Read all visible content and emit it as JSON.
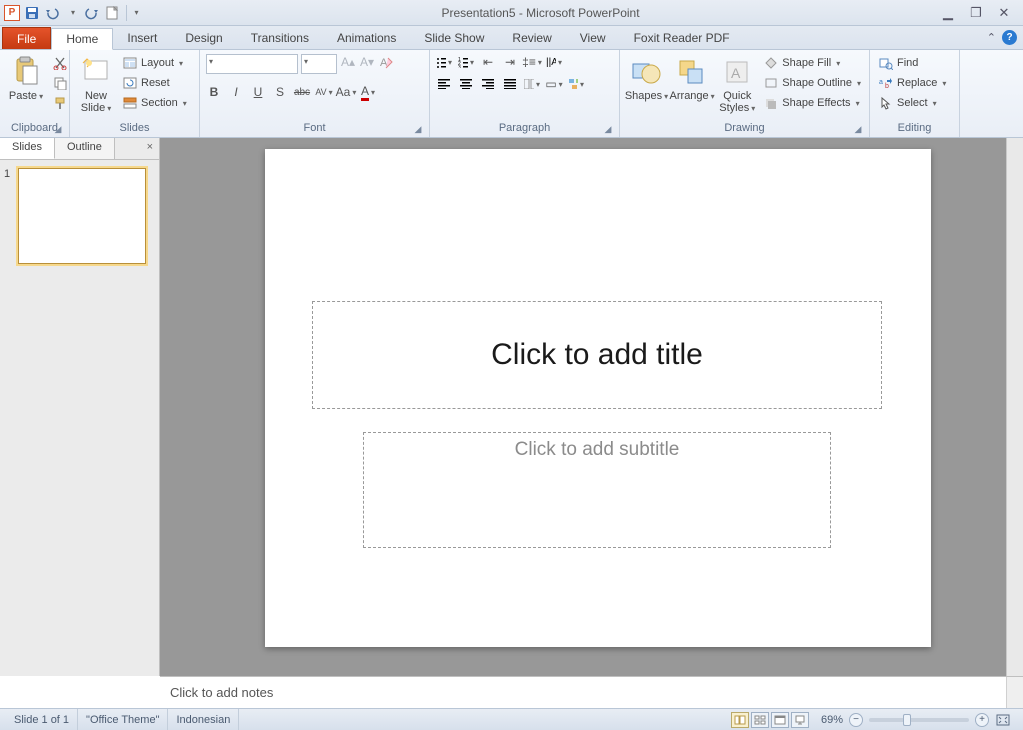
{
  "titlebar": {
    "app_letter": "P",
    "title": "Presentation5 - Microsoft PowerPoint"
  },
  "tabs": {
    "file": "File",
    "items": [
      "Home",
      "Insert",
      "Design",
      "Transitions",
      "Animations",
      "Slide Show",
      "Review",
      "View",
      "Foxit Reader PDF"
    ],
    "active_index": 0
  },
  "ribbon": {
    "clipboard": {
      "label": "Clipboard",
      "paste": "Paste",
      "cut": "Cut",
      "copy": "Copy",
      "painter": "Format Painter"
    },
    "slides": {
      "label": "Slides",
      "newslide": "New\nSlide",
      "layout": "Layout",
      "reset": "Reset",
      "section": "Section"
    },
    "font": {
      "label": "Font",
      "bold": "B",
      "italic": "I",
      "underline": "U",
      "shadow": "S",
      "strike": "abc",
      "spacing": "AV",
      "case": "Aa",
      "color": "A"
    },
    "paragraph": {
      "label": "Paragraph"
    },
    "drawing": {
      "label": "Drawing",
      "shapes": "Shapes",
      "arrange": "Arrange",
      "quick": "Quick\nStyles",
      "fill": "Shape Fill",
      "outline": "Shape Outline",
      "effects": "Shape Effects"
    },
    "editing": {
      "label": "Editing",
      "find": "Find",
      "replace": "Replace",
      "select": "Select"
    }
  },
  "sidepanel": {
    "tabs": {
      "slides": "Slides",
      "outline": "Outline"
    },
    "thumb_number": "1"
  },
  "slide": {
    "title_placeholder": "Click to add title",
    "subtitle_placeholder": "Click to add subtitle"
  },
  "notes": {
    "placeholder": "Click to add notes"
  },
  "status": {
    "slide": "Slide 1 of 1",
    "theme": "\"Office Theme\"",
    "language": "Indonesian",
    "zoom": "69%"
  }
}
